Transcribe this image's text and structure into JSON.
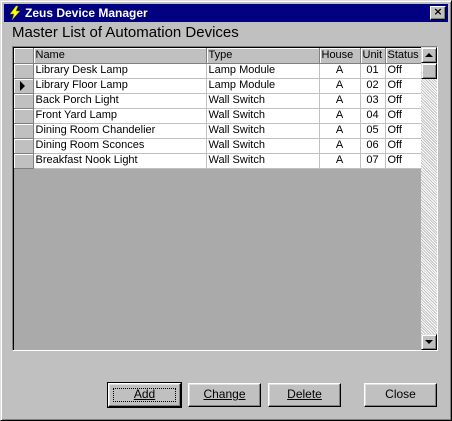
{
  "window": {
    "title": "Zeus Device Manager",
    "close_glyph": "×"
  },
  "heading": "Master List of Automation Devices",
  "grid": {
    "columns": [
      "Name",
      "Type",
      "House",
      "Unit",
      "Status"
    ],
    "current_row_index": 1,
    "rows": [
      {
        "name": "Library Desk Lamp",
        "type": "Lamp Module",
        "house": "A",
        "unit": "01",
        "status": "Off"
      },
      {
        "name": "Library Floor Lamp",
        "type": "Lamp Module",
        "house": "A",
        "unit": "02",
        "status": "Off"
      },
      {
        "name": "Back Porch Light",
        "type": "Wall Switch",
        "house": "A",
        "unit": "03",
        "status": "Off"
      },
      {
        "name": "Front Yard Lamp",
        "type": "Wall Switch",
        "house": "A",
        "unit": "04",
        "status": "Off"
      },
      {
        "name": "Dining Room Chandelier",
        "type": "Wall Switch",
        "house": "A",
        "unit": "05",
        "status": "Off"
      },
      {
        "name": "Dining Room Sconces",
        "type": "Wall Switch",
        "house": "A",
        "unit": "06",
        "status": "Off"
      },
      {
        "name": "Breakfast Nook Light",
        "type": "Wall Switch",
        "house": "A",
        "unit": "07",
        "status": "Off"
      }
    ]
  },
  "buttons": {
    "add": "Add",
    "change": "Change",
    "delete": "Delete",
    "close": "Close"
  },
  "colors": {
    "titlebar": "#000080",
    "face": "#c0c0c0",
    "grid_background": "#aaaaaa"
  },
  "icons": {
    "app": "lightning-bolt-icon",
    "close": "close-icon",
    "row_indicator": "current-row-arrow-icon",
    "scroll_up": "scroll-up-arrow-icon",
    "scroll_down": "scroll-down-arrow-icon"
  }
}
